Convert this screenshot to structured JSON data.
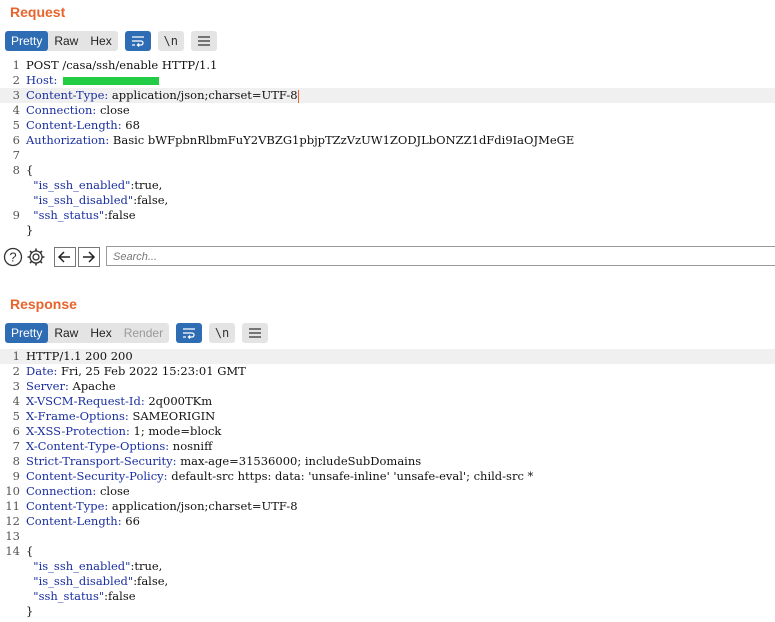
{
  "request": {
    "title": "Request",
    "view_tabs": [
      "Pretty",
      "Raw",
      "Hex"
    ],
    "wrap_icon": "wrap-lines-icon",
    "newline_label": "\\n",
    "menu_icon": "hamburger-menu-icon",
    "lines": [
      {
        "n": "1",
        "text": "POST /casa/ssh/enable HTTP/1.1"
      },
      {
        "n": "2",
        "key": "Host:",
        "text": ""
      },
      {
        "n": "3",
        "key": "Content-Type:",
        "text": " application/json;charset=UTF-8"
      },
      {
        "n": "4",
        "key": "Connection:",
        "text": " close"
      },
      {
        "n": "5",
        "key": "Content-Length:",
        "text": " 68"
      },
      {
        "n": "6",
        "key": "Authorization:",
        "text": " Basic bWFpbnRlbmFuY2VBZG1pbjpTZzVzUW1ZODJLbONZZ1dFdi9IaOJMeGE"
      },
      {
        "n": "7",
        "text": ""
      },
      {
        "n": "8",
        "text": "{"
      },
      {
        "n": "",
        "jkey": "  \"is_ssh_enabled\"",
        "text": ":true,"
      },
      {
        "n": "",
        "jkey": "  \"is_ssh_disabled\"",
        "text": ":false,"
      },
      {
        "n": "9",
        "jkey": "  \"ssh_status\"",
        "text": ":false"
      },
      {
        "n": "",
        "text": "}"
      }
    ]
  },
  "search": {
    "placeholder": "Search..."
  },
  "response": {
    "title": "Response",
    "view_tabs": [
      "Pretty",
      "Raw",
      "Hex",
      "Render"
    ],
    "wrap_icon": "wrap-lines-icon",
    "newline_label": "\\n",
    "menu_icon": "hamburger-menu-icon",
    "lines": [
      {
        "n": "1",
        "text": "HTTP/1.1 200 200"
      },
      {
        "n": "2",
        "key": "Date:",
        "text": " Fri, 25 Feb 2022 15:23:01 GMT"
      },
      {
        "n": "3",
        "key": "Server:",
        "text": " Apache"
      },
      {
        "n": "4",
        "key": "X-VSCM-Request-Id:",
        "text": " 2q000TKm"
      },
      {
        "n": "5",
        "key": "X-Frame-Options:",
        "text": " SAMEORIGIN"
      },
      {
        "n": "6",
        "key": "X-XSS-Protection:",
        "text": " 1; mode=block"
      },
      {
        "n": "7",
        "key": "X-Content-Type-Options:",
        "text": " nosniff"
      },
      {
        "n": "8",
        "key": "Strict-Transport-Security:",
        "text": " max-age=31536000; includeSubDomains"
      },
      {
        "n": "9",
        "key": "Content-Security-Policy:",
        "text": " default-src https: data: 'unsafe-inline' 'unsafe-eval'; child-src *"
      },
      {
        "n": "10",
        "key": "Connection:",
        "text": " close"
      },
      {
        "n": "11",
        "key": "Content-Type:",
        "text": " application/json;charset=UTF-8"
      },
      {
        "n": "12",
        "key": "Content-Length:",
        "text": " 66"
      },
      {
        "n": "13",
        "text": ""
      },
      {
        "n": "14",
        "text": "{"
      },
      {
        "n": "",
        "jkey": "  \"is_ssh_enabled\"",
        "text": ":true,"
      },
      {
        "n": "",
        "jkey": "  \"is_ssh_disabled\"",
        "text": ":false,"
      },
      {
        "n": "",
        "jkey": "  \"ssh_status\"",
        "text": ":false"
      },
      {
        "n": "",
        "text": "}"
      }
    ]
  },
  "colors": {
    "accent": "#e8642c",
    "active_tab": "#2e6db4",
    "header_key": "#1a2fa0",
    "redaction": "#22cc44"
  }
}
